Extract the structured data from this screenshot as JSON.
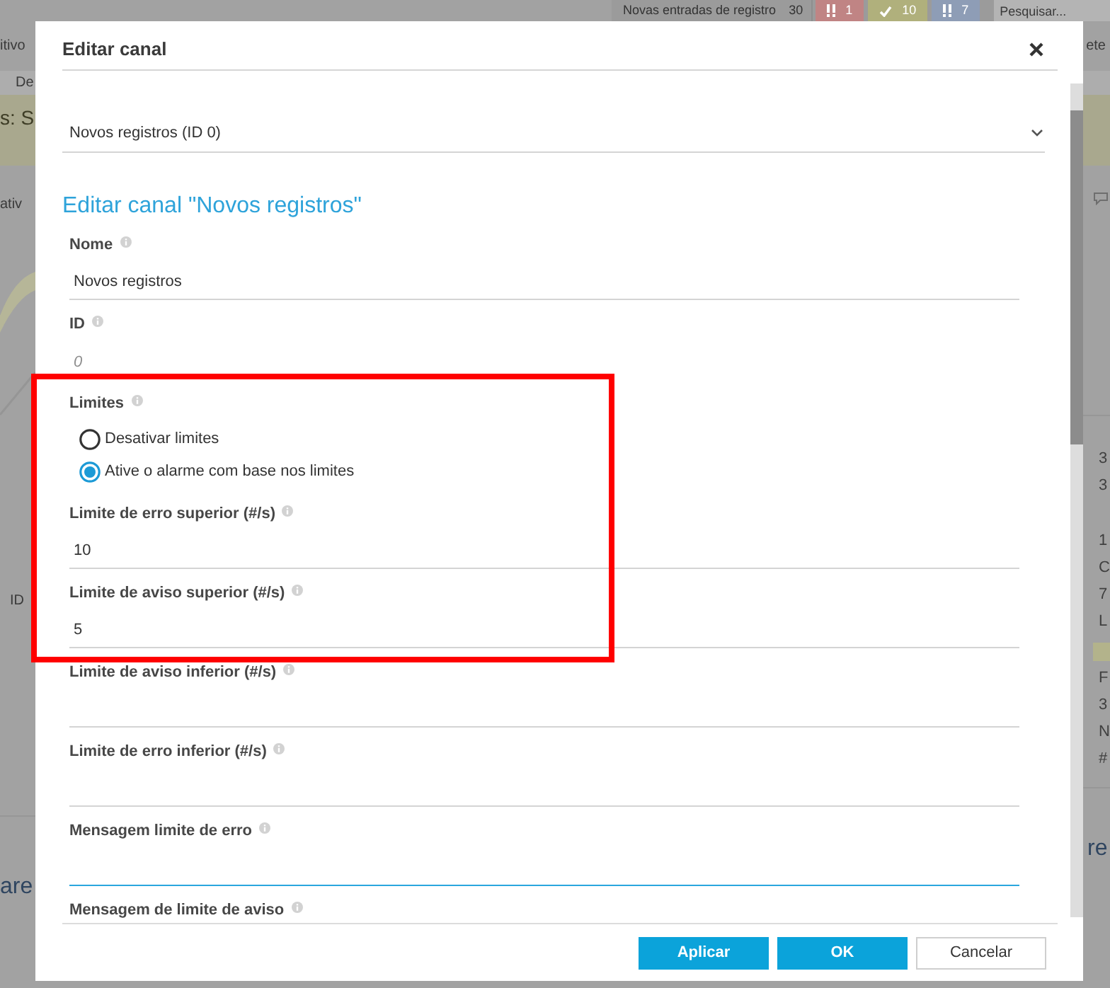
{
  "background": {
    "notification_bar": {
      "label": "Novas entradas de registro",
      "count": "30",
      "badges": [
        {
          "kind": "alert",
          "value": "1",
          "color": "#c08484"
        },
        {
          "kind": "check",
          "value": "10",
          "color": "#b0b07c"
        },
        {
          "kind": "alert",
          "value": "7",
          "color": "#8e9db6"
        }
      ],
      "search": {
        "placeholder": "Pesquisar..."
      }
    },
    "left_edge": {
      "nav_link": "itivo",
      "tab": "De",
      "page_title": "s: S",
      "subnav_link": "ativ",
      "field_label": "ID",
      "section_title": "are"
    },
    "right_edge": {
      "nav_link": "ete",
      "values": [
        "3",
        "3"
      ],
      "details": [
        "1",
        "C",
        "7",
        "L"
      ],
      "details_more": [
        "F",
        "3",
        "N",
        "#"
      ],
      "section_title": "re"
    }
  },
  "dialog": {
    "title": "Editar canal",
    "channel_select": {
      "value": "Novos registros (ID 0)"
    },
    "heading": "Editar canal \"Novos registros\"",
    "fields": [
      {
        "kind": "text",
        "label": "Nome",
        "value": "Novos registros",
        "focused": false
      },
      {
        "kind": "readonly",
        "label": "ID",
        "value": "0"
      },
      {
        "kind": "radio",
        "label": "Limites",
        "options": [
          {
            "label": "Desativar limites",
            "selected": false
          },
          {
            "label": "Ative o alarme com base nos limites",
            "selected": true
          }
        ]
      },
      {
        "kind": "text",
        "label": "Limite de erro superior (#/s)",
        "value": "10",
        "focused": false
      },
      {
        "kind": "text",
        "label": "Limite de aviso superior (#/s)",
        "value": "5",
        "focused": false
      },
      {
        "kind": "text",
        "label": "Limite de aviso inferior (#/s)",
        "focused": false
      },
      {
        "kind": "text",
        "label": "Limite de erro inferior (#/s)",
        "focused": false
      },
      {
        "kind": "text",
        "label": "Mensagem limite de erro",
        "focused": true
      },
      {
        "kind": "label",
        "label": "Mensagem de limite de aviso"
      }
    ],
    "buttons": [
      {
        "kind": "primary",
        "label": "Aplicar"
      },
      {
        "kind": "primary",
        "label": "OK"
      },
      {
        "kind": "secondary",
        "label": "Cancelar"
      }
    ]
  }
}
